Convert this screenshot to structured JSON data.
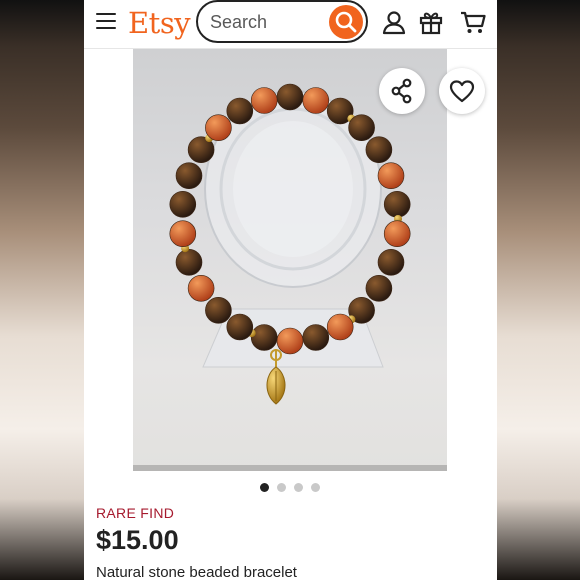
{
  "header": {
    "logo": "Etsy",
    "search_placeholder": "Search",
    "icons": [
      "menu-icon",
      "search-icon",
      "account-icon",
      "gift-icon",
      "cart-icon"
    ]
  },
  "listing": {
    "image_alt": "Bracelet of orange and brown stone beads with gold spacers and a gold leaf charm on a clear acrylic display stand",
    "carousel": {
      "total": 4,
      "active": 1
    },
    "badge": "RARE FIND",
    "price": "$15.00",
    "title": "Natural stone beaded bracelet"
  },
  "actions": [
    "share-icon",
    "heart-icon"
  ],
  "colors": {
    "brand": "#f1641e",
    "badge": "#a61a2e",
    "text": "#222222"
  }
}
